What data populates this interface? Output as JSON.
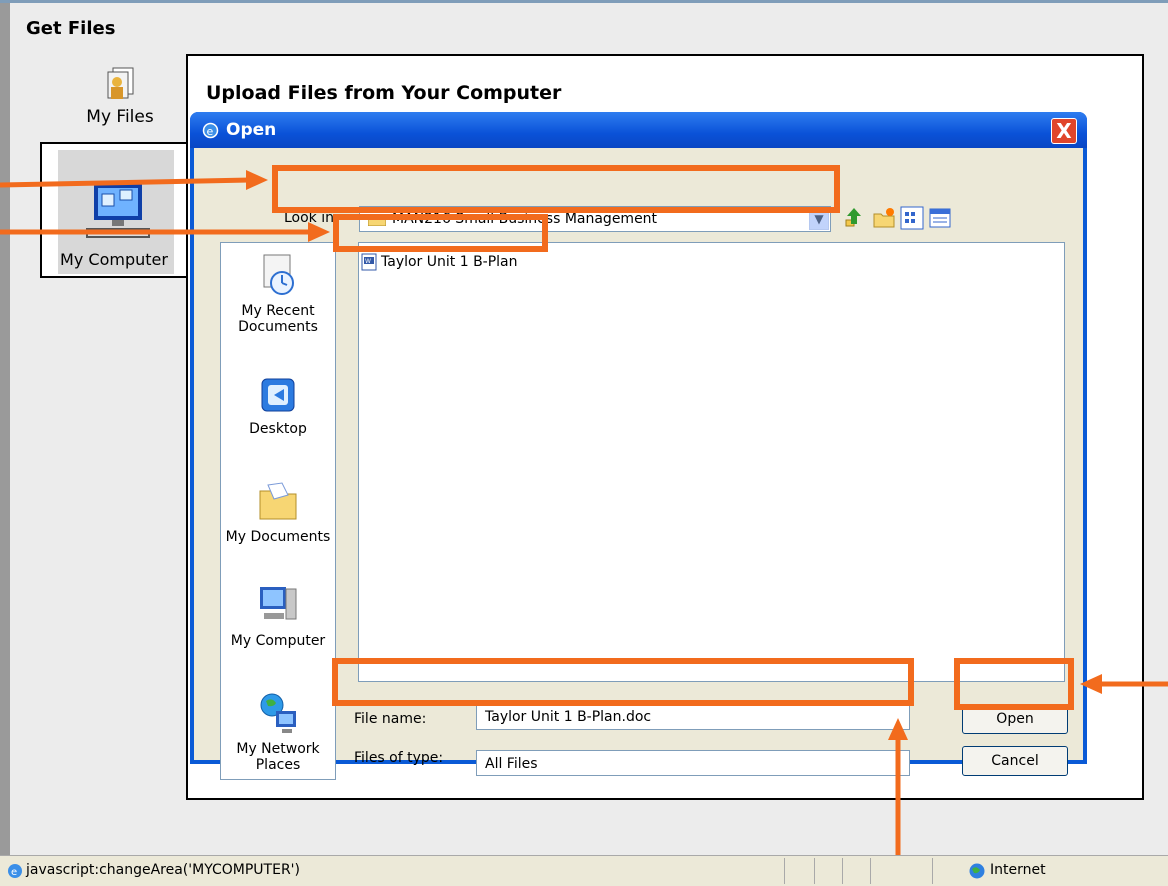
{
  "page": {
    "title": "Get Files",
    "nav": {
      "my_files": "My Files",
      "my_computer": "My Computer"
    },
    "upload_title": "Upload Files from Your Computer"
  },
  "dialog": {
    "title": "Open",
    "close_label": "X",
    "look_in_label": "Look in:",
    "look_in_value": "MAN216 Small Business Management",
    "places": [
      {
        "label": "My Recent Documents"
      },
      {
        "label": "Desktop"
      },
      {
        "label": "My Documents"
      },
      {
        "label": "My Computer"
      },
      {
        "label": "My Network Places"
      }
    ],
    "files": [
      {
        "name": "Taylor Unit 1 B-Plan"
      }
    ],
    "file_name_label": "File name:",
    "file_name_value": "Taylor Unit 1 B-Plan.doc",
    "files_of_type_label": "Files of type:",
    "files_of_type_value": "All Files",
    "open_button": "Open",
    "cancel_button": "Cancel"
  },
  "statusbar": {
    "message": "javascript:changeArea('MYCOMPUTER')",
    "zone": "Internet"
  },
  "colors": {
    "highlight": "#f26b1d",
    "title_bar": "#0a52d8"
  }
}
